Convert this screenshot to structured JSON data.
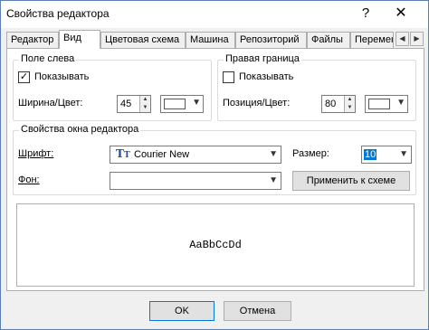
{
  "window": {
    "title": "Свойства редактора",
    "help_glyph": "?",
    "close_glyph": "✕"
  },
  "tabs": [
    {
      "label": "Редактор",
      "active": false
    },
    {
      "label": "Вид",
      "active": true
    },
    {
      "label": "Цветовая схема",
      "active": false
    },
    {
      "label": "Машина",
      "active": false
    },
    {
      "label": "Репозиторий",
      "active": false
    },
    {
      "label": "Файлы",
      "active": false
    },
    {
      "label": "Перемен",
      "active": false
    }
  ],
  "tab_scroll": {
    "left": "◀",
    "right": "▶"
  },
  "left_margin": {
    "title": "Поле слева",
    "show_label": "Показывать",
    "show_checked": true,
    "check_glyph": "✓",
    "width_label": "Ширина/Цвет:",
    "width_value": "45",
    "color": "#ffffff"
  },
  "right_margin": {
    "title": "Правая граница",
    "show_label": "Показывать",
    "show_checked": false,
    "check_glyph": "",
    "position_label": "Позиция/Цвет:",
    "position_value": "80",
    "color": "#ffffff"
  },
  "editor_window": {
    "title": "Свойства окна редактора",
    "font_label": "Шрифт:",
    "font_value": "Courier New",
    "font_icon": "TrueType",
    "size_label": "Размер:",
    "size_value": "10",
    "background_label": "Фон:",
    "background_value": "",
    "apply_scheme_label": "Применить к схеме"
  },
  "spin_arrows": {
    "up": "▲",
    "down": "▼"
  },
  "dropdown_glyph": "▼",
  "preview": {
    "sample_text": "AaBbCcDd"
  },
  "footer": {
    "ok_label": "OK",
    "cancel_label": "Отмена"
  }
}
